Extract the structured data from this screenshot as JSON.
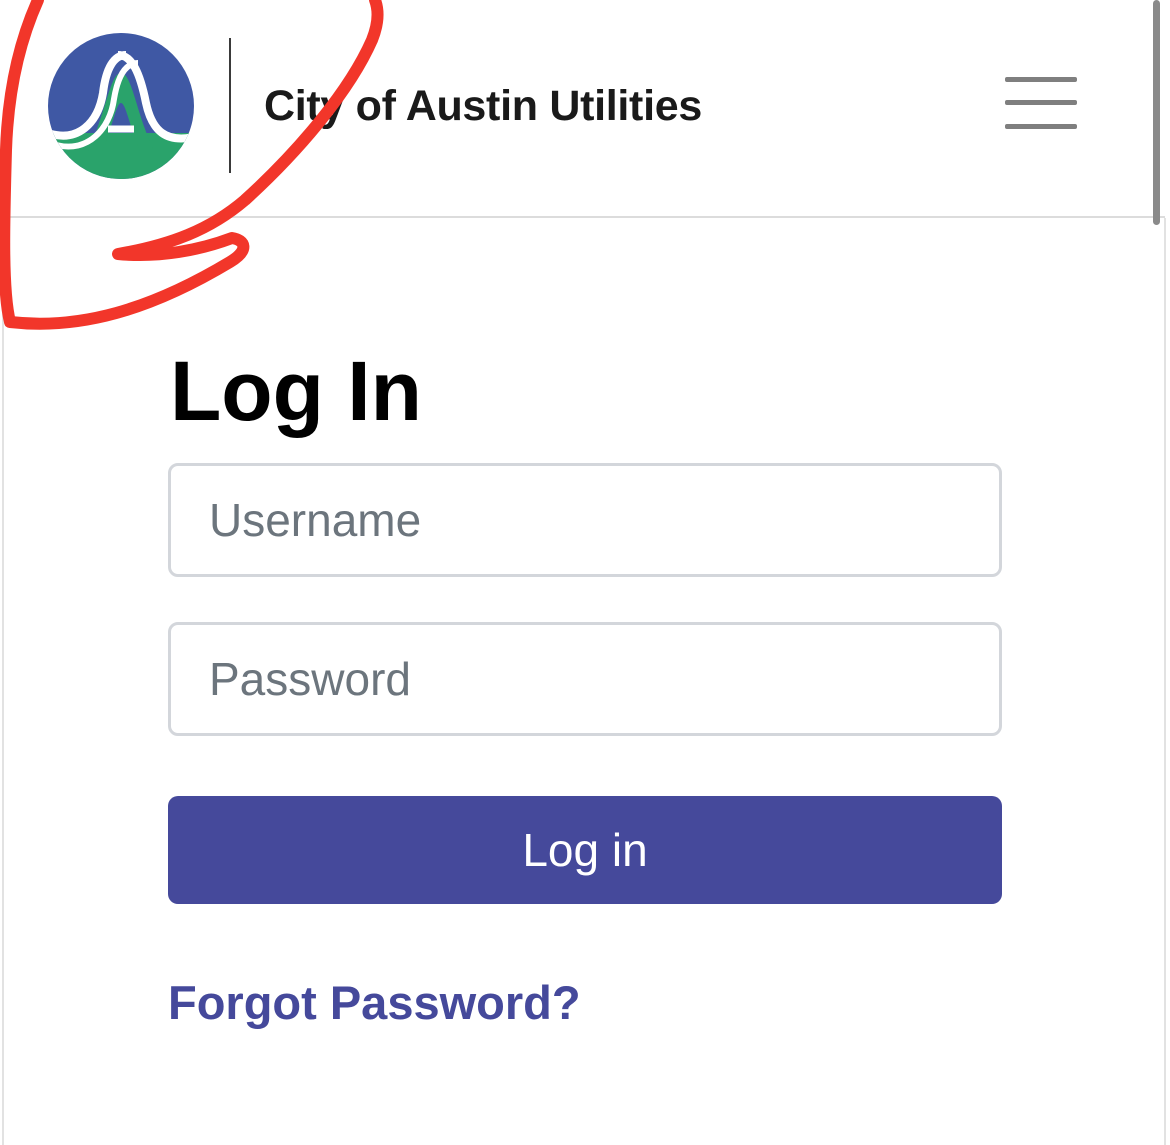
{
  "header": {
    "brand_name": "City of Austin Utilities",
    "logo_icon": "city-of-austin-logo",
    "menu_icon": "hamburger-menu-icon"
  },
  "login": {
    "title": "Log In",
    "username_placeholder": "Username",
    "password_placeholder": "Password",
    "submit_label": "Log in",
    "forgot_link": "Forgot Password?"
  },
  "colors": {
    "primary": "#45499b",
    "logo_blue": "#3f58a4",
    "logo_green": "#2aa36b",
    "annotation_red": "#f2362a"
  }
}
